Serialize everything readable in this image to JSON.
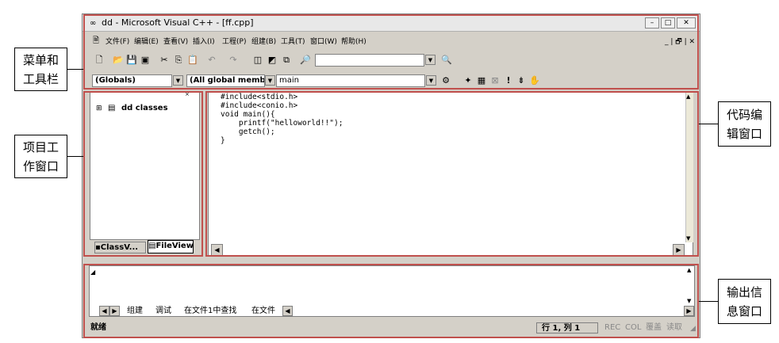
{
  "window": {
    "title": "dd - Microsoft Visual C++ - [ff.cpp]",
    "min_label": "–",
    "max_label": "□",
    "close_label": "✕"
  },
  "menubar": {
    "items": [
      "文件(F)",
      "编辑(E)",
      "查看(V)",
      "插入(I)",
      "工程(P)",
      "组建(B)",
      "工具(T)",
      "窗口(W)",
      "帮助(H)"
    ],
    "mdi_controls": "_ | 🗗 | ✕"
  },
  "toolbar": {
    "find_combo_value": ""
  },
  "wizardbar": {
    "class_combo": "(Globals)",
    "filter_combo": "(All global member:",
    "function_combo": "main"
  },
  "workspace": {
    "tree_root": "dd classes",
    "tab_classview": "ClassV...",
    "tab_fileview": "FileView"
  },
  "editor": {
    "code_lines": [
      "#include<stdio.h>",
      "#include<conio.h>",
      "void main(){",
      "    printf(\"helloworld!!\");",
      "    getch();",
      "}"
    ]
  },
  "output": {
    "tabs": [
      "组建",
      "调试",
      "在文件1中查找",
      "在文件"
    ]
  },
  "statusbar": {
    "ready": "就绪",
    "position": "行 1, 列 1",
    "rec": "REC",
    "col": "COL",
    "ovr": "覆盖",
    "read": "读取"
  },
  "annotations": {
    "menu_toolbar": [
      "菜单和",
      "工具栏"
    ],
    "project_window": [
      "项目工",
      "作窗口"
    ],
    "code_window": [
      "代码编",
      "辑窗口"
    ],
    "output_window": [
      "输出信",
      "息窗口"
    ]
  },
  "colors": {
    "highlight_box": "#c0504d",
    "face": "#d4d0c8"
  }
}
